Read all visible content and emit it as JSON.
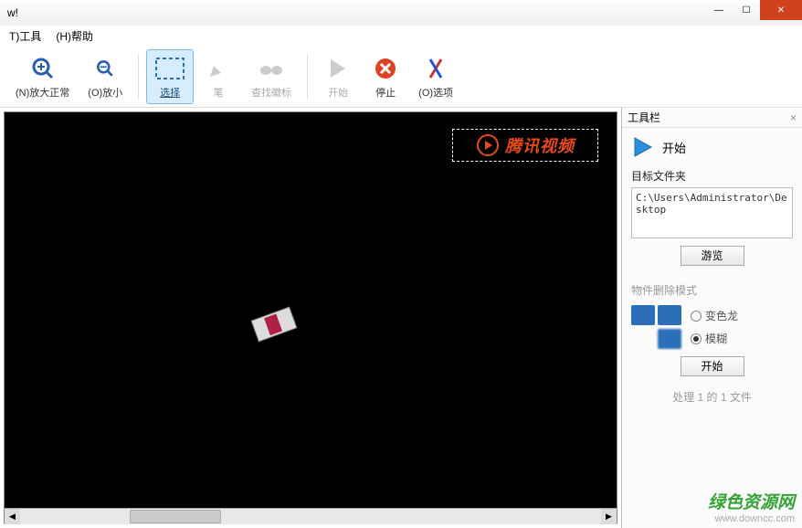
{
  "window": {
    "title": "w!"
  },
  "menubar": {
    "tools": "T)工具",
    "help": "(H)帮助"
  },
  "toolbar": {
    "zoom_normal": "(N)放大正常",
    "zoom_out": "(O)放小",
    "select": "选择",
    "pen": "笔",
    "find_logo": "查找徽标",
    "start": "开始",
    "stop": "停止",
    "options": "(O)选项"
  },
  "canvas": {
    "watermark_text": "腾讯视频"
  },
  "sidepanel": {
    "title": "工具栏",
    "close": "×",
    "start_label": "开始",
    "target_folder_label": "目标文件夹",
    "target_folder_value": "C:\\Users\\Administrator\\Desktop",
    "browse_label": "游览",
    "mode_title": "物件删除模式",
    "mode_chameleon": "变色龙",
    "mode_blur": "模糊",
    "start_btn": "开始",
    "status": "处理 1 的 1 文件"
  },
  "site_mark": {
    "line1": "绿色资源网",
    "line2": "www.downcc.com"
  }
}
